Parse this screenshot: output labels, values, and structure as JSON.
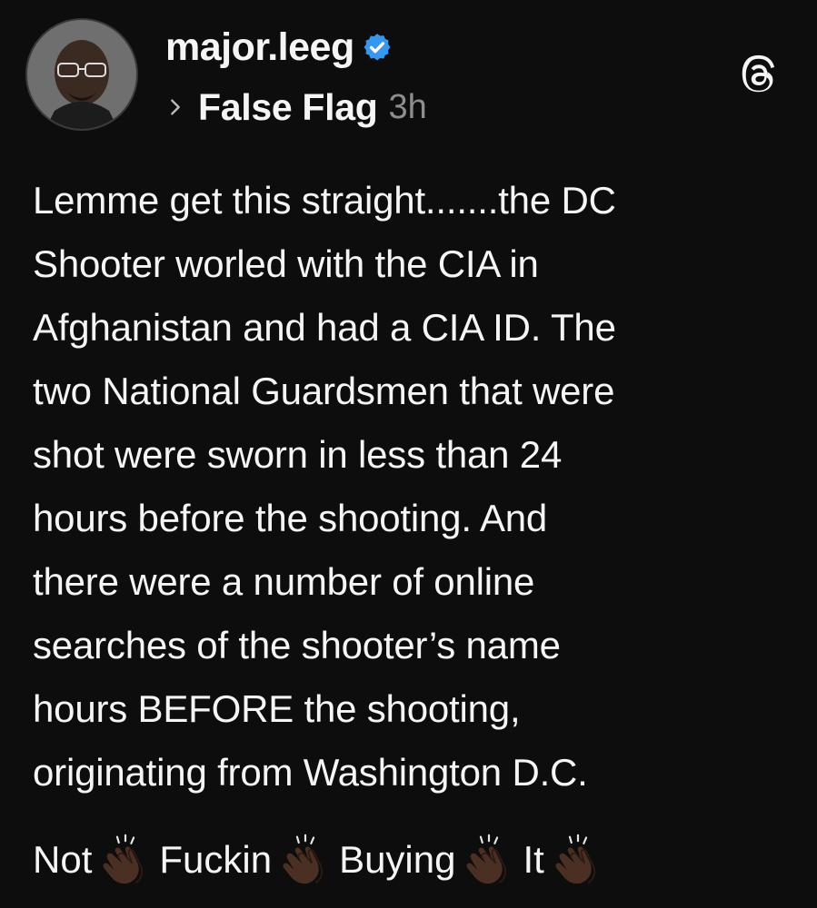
{
  "post": {
    "username": "major.leeg",
    "topic": "False Flag",
    "time": "3h",
    "body_lines": [
      "Lemme get this straight.......the DC",
      "Shooter worled with the CIA in",
      "Afghanistan and had a CIA ID. The",
      "two National Guardsmen that were",
      "shot were sworn in less than 24",
      "hours before the shooting. And",
      "there were a number of online",
      "searches of the shooter’s name",
      "hours BEFORE the shooting,",
      "originating from Washington D.C."
    ],
    "closing_words": [
      "Not",
      "Fuckin",
      "Buying",
      "It"
    ]
  },
  "icons": {
    "avatar": "profile-photo",
    "verified": "verified-badge-icon",
    "chevron": "chevron-right-icon",
    "app_logo": "threads-logo-icon",
    "clap": "clapping-hands-emoji"
  },
  "colors": {
    "background": "#0d0d0d",
    "text": "#f5f5f5",
    "muted": "#8e8e8e",
    "verified_blue": "#3797f0"
  }
}
